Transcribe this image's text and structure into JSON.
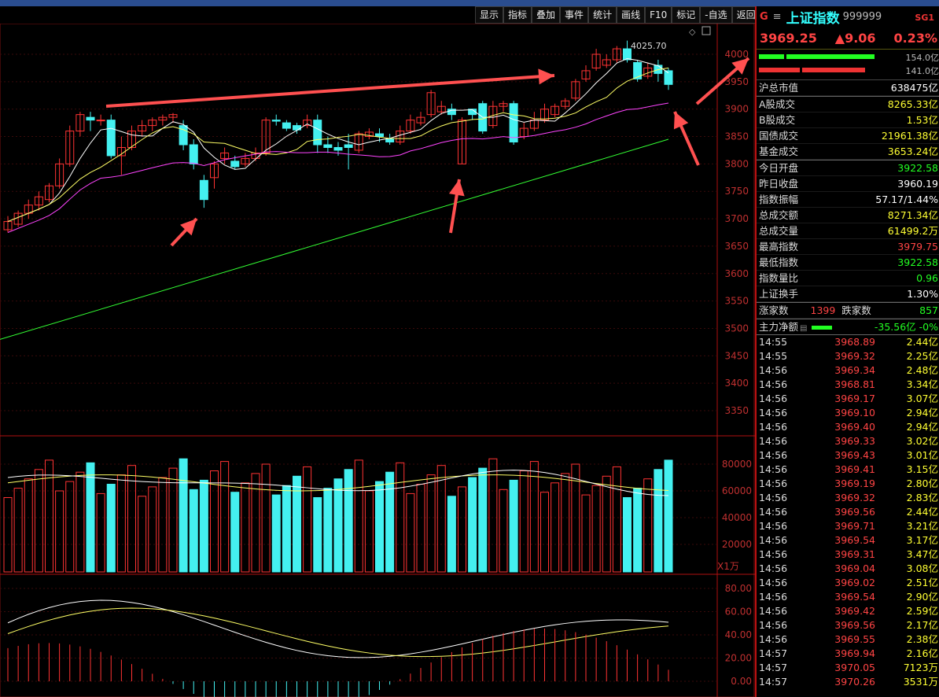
{
  "toolbar": [
    "显示",
    "指标",
    "叠加",
    "事件",
    "统计",
    "画线",
    "F10",
    "标记",
    "-自选",
    "返回"
  ],
  "chart": {
    "peak_label": "4025.70",
    "x1_label": "X1万",
    "price_ticks": [
      "4000",
      "3950",
      "3900",
      "3850",
      "3800",
      "3750",
      "3700",
      "3650",
      "3600",
      "3550",
      "3500",
      "3450",
      "3400",
      "3350"
    ],
    "volume_ticks": [
      "80000",
      "60000",
      "40000",
      "20000"
    ],
    "indicator_ticks": [
      "80.00",
      "60.00",
      "40.00",
      "20.00",
      "0.00"
    ],
    "colors": {
      "up": "#ff3333",
      "down": "#44f0f0",
      "ma5": "#ffffff",
      "ma10": "#ffff66",
      "ma20": "#ff44ff",
      "ma60": "#33ff33",
      "arrow": "#ff5050"
    }
  },
  "panel": {
    "g": "G",
    "menu_icon": "list-icon",
    "name": "上证指数",
    "code": "999999",
    "sg": "SG1",
    "price": "3969.25",
    "change": "▲9.06",
    "pct": "0.23%",
    "buy_vol": "154.0亿",
    "sell_vol": "141.0亿",
    "stats": [
      {
        "label": "沪总市值",
        "value": "638475亿",
        "color": "white"
      },
      {
        "label": "A股成交",
        "value": "8265.33亿",
        "color": "yellow"
      },
      {
        "label": "B股成交",
        "value": "1.53亿",
        "color": "yellow"
      },
      {
        "label": "国债成交",
        "value": "21961.38亿",
        "color": "yellow"
      },
      {
        "label": "基金成交",
        "value": "3653.24亿",
        "color": "yellow"
      },
      {
        "label": "今日开盘",
        "value": "3922.58",
        "color": "green"
      },
      {
        "label": "昨日收盘",
        "value": "3960.19",
        "color": "white"
      },
      {
        "label": "指数振幅",
        "value": "57.17/1.44%",
        "color": "white"
      },
      {
        "label": "总成交额",
        "value": "8271.34亿",
        "color": "yellow"
      },
      {
        "label": "总成交量",
        "value": "61499.2万",
        "color": "yellow"
      },
      {
        "label": "最高指数",
        "value": "3979.75",
        "color": "red"
      },
      {
        "label": "最低指数",
        "value": "3922.58",
        "color": "green"
      },
      {
        "label": "指数量比",
        "value": "0.96",
        "color": "green"
      },
      {
        "label": "上证换手",
        "value": "1.30%",
        "color": "white"
      }
    ],
    "up_label": "涨家数",
    "up_count": "1399",
    "down_label": "跌家数",
    "down_count": "857",
    "flow_label": "主力净额",
    "flow_value": "-35.56亿",
    "flow_pct": "-0%",
    "ticks": [
      {
        "t": "14:55",
        "p": "3968.89",
        "v": "2.44亿"
      },
      {
        "t": "14:55",
        "p": "3969.32",
        "v": "2.25亿"
      },
      {
        "t": "14:56",
        "p": "3969.34",
        "v": "2.48亿"
      },
      {
        "t": "14:56",
        "p": "3968.81",
        "v": "3.34亿"
      },
      {
        "t": "14:56",
        "p": "3969.17",
        "v": "3.07亿"
      },
      {
        "t": "14:56",
        "p": "3969.10",
        "v": "2.94亿"
      },
      {
        "t": "14:56",
        "p": "3969.40",
        "v": "2.94亿"
      },
      {
        "t": "14:56",
        "p": "3969.33",
        "v": "3.02亿"
      },
      {
        "t": "14:56",
        "p": "3969.43",
        "v": "3.01亿"
      },
      {
        "t": "14:56",
        "p": "3969.41",
        "v": "3.15亿"
      },
      {
        "t": "14:56",
        "p": "3969.19",
        "v": "2.80亿"
      },
      {
        "t": "14:56",
        "p": "3969.32",
        "v": "2.83亿"
      },
      {
        "t": "14:56",
        "p": "3969.56",
        "v": "2.44亿"
      },
      {
        "t": "14:56",
        "p": "3969.71",
        "v": "3.21亿"
      },
      {
        "t": "14:56",
        "p": "3969.54",
        "v": "3.17亿"
      },
      {
        "t": "14:56",
        "p": "3969.31",
        "v": "3.47亿"
      },
      {
        "t": "14:56",
        "p": "3969.04",
        "v": "3.08亿"
      },
      {
        "t": "14:56",
        "p": "3969.02",
        "v": "2.51亿"
      },
      {
        "t": "14:56",
        "p": "3969.54",
        "v": "2.90亿"
      },
      {
        "t": "14:56",
        "p": "3969.42",
        "v": "2.59亿"
      },
      {
        "t": "14:56",
        "p": "3969.56",
        "v": "2.17亿"
      },
      {
        "t": "14:56",
        "p": "3969.55",
        "v": "2.38亿"
      },
      {
        "t": "14:57",
        "p": "3969.94",
        "v": "2.16亿"
      },
      {
        "t": "14:57",
        "p": "3970.05",
        "v": "7123万"
      },
      {
        "t": "14:57",
        "p": "3970.26",
        "v": "3531万"
      }
    ]
  }
}
